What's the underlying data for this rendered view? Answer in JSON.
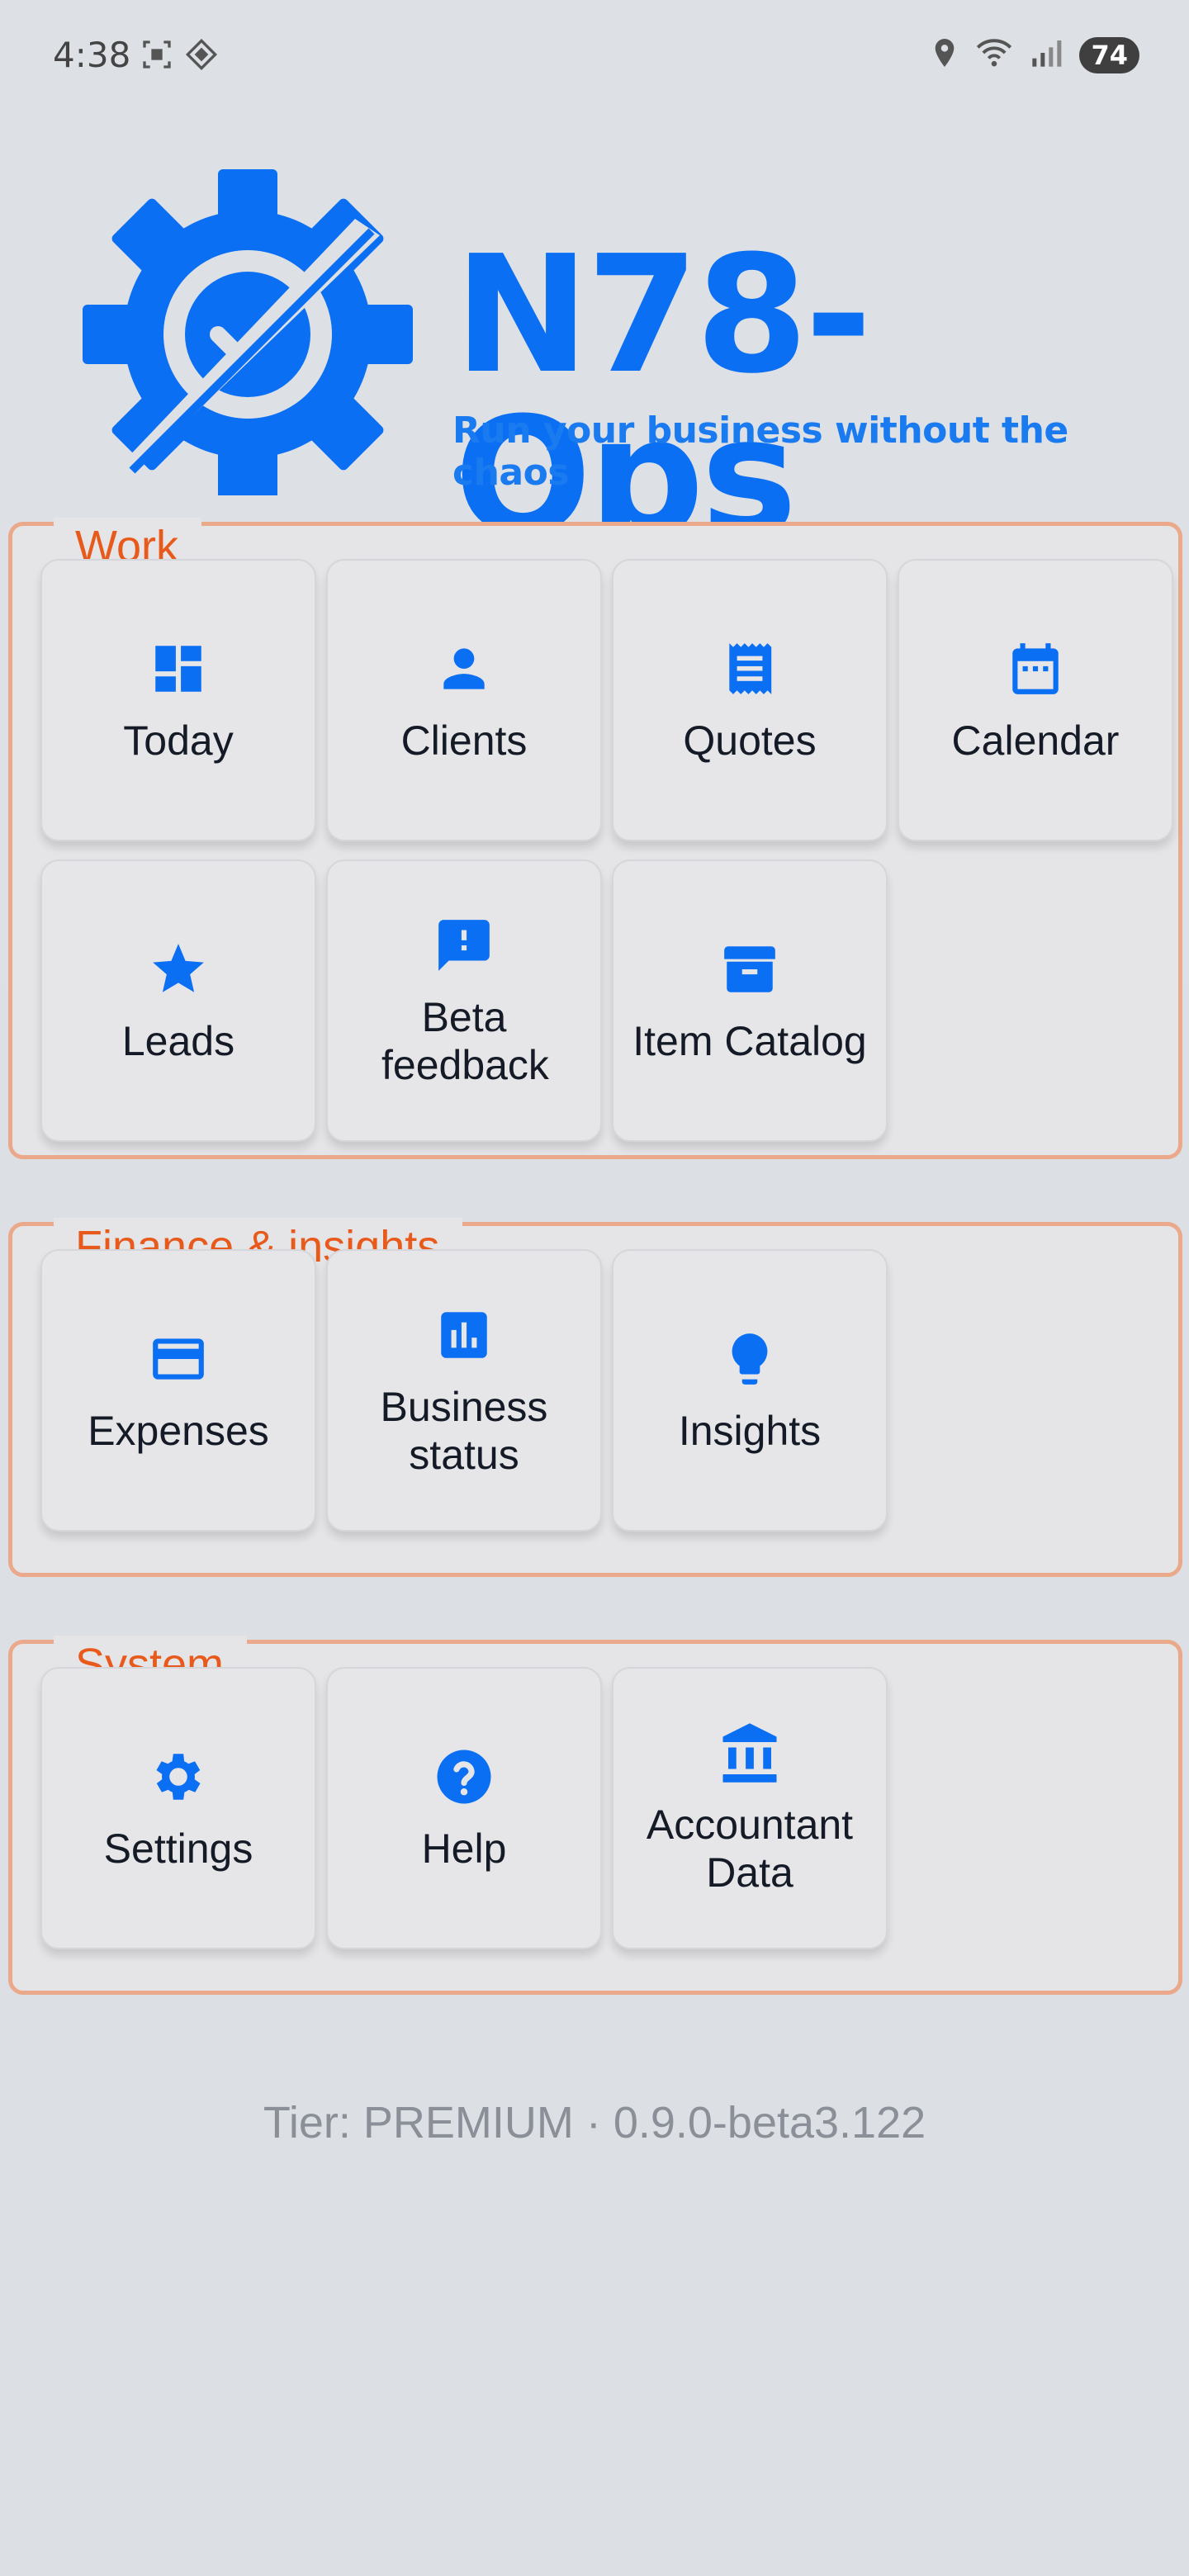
{
  "status_bar": {
    "time": "4:38",
    "battery": "74"
  },
  "header": {
    "brand": "N78-Ops",
    "tagline": "Run your business without the chaos"
  },
  "sections": [
    {
      "title": "Work",
      "tiles": [
        {
          "label": "Today",
          "icon": "dashboard-icon"
        },
        {
          "label": "Clients",
          "icon": "person-icon"
        },
        {
          "label": "Quotes",
          "icon": "receipt-icon"
        },
        {
          "label": "Calendar",
          "icon": "calendar-icon"
        },
        {
          "label": "Leads",
          "icon": "star-icon"
        },
        {
          "label": "Beta feedback",
          "icon": "feedback-icon"
        },
        {
          "label": "Item Catalog",
          "icon": "archive-icon"
        }
      ]
    },
    {
      "title": "Finance & insights",
      "tiles": [
        {
          "label": "Expenses",
          "icon": "credit-card-icon"
        },
        {
          "label": "Business status",
          "icon": "bar-chart-icon"
        },
        {
          "label": "Insights",
          "icon": "lightbulb-icon"
        }
      ]
    },
    {
      "title": "System",
      "tiles": [
        {
          "label": "Settings",
          "icon": "gear-icon"
        },
        {
          "label": "Help",
          "icon": "help-icon"
        },
        {
          "label": "Accountant Data",
          "icon": "bank-icon"
        }
      ]
    }
  ],
  "footer": {
    "text": "Tier: PREMIUM · 0.9.0-beta3.122"
  },
  "colors": {
    "accent": "#0a6ff2",
    "section_title": "#e85a1b",
    "section_border": "#eaa98a"
  }
}
